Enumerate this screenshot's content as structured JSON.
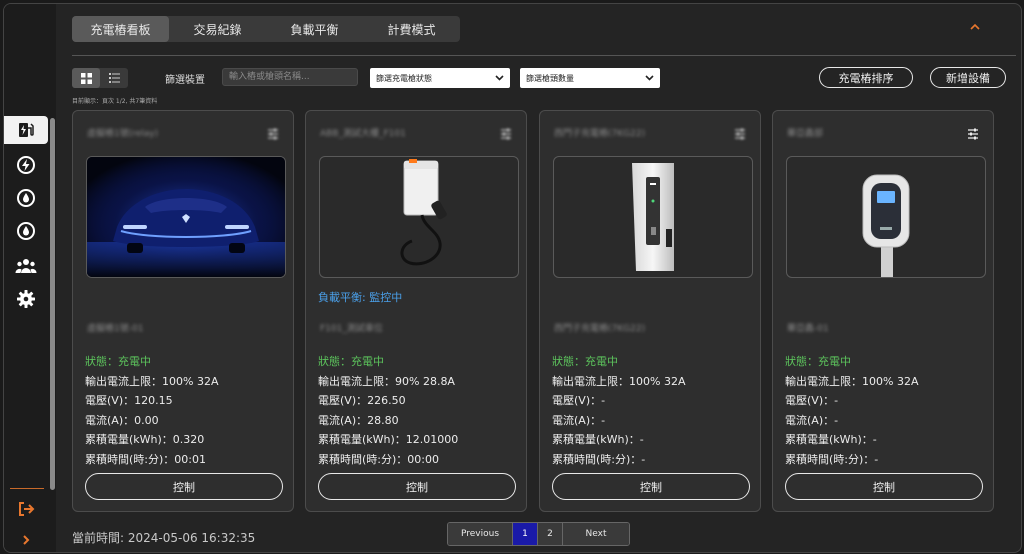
{
  "tabs": [
    "充電樁看板",
    "交易紀錄",
    "負載平衡",
    "計費模式"
  ],
  "toolbar": {
    "filter_label": "篩選裝置",
    "search_placeholder": "輸入樁或槍頭名稱...",
    "status_select": "篩選充電槍狀態",
    "count_select": "篩選槍頭數量",
    "sort_button": "充電樁排序",
    "add_button": "新增設備",
    "status_line": "目前顯示：頁次 1/2, 共7筆資料"
  },
  "cards": [
    {
      "title": "虛擬樁1號(relay)",
      "subtitle": "虛擬樁1號-01",
      "load_balance": "",
      "status": "狀態：充電中",
      "current_limit": "輸出電流上限：100% 32A",
      "voltage": "電壓(V)：120.15",
      "current": "電流(A)：0.00",
      "energy": "累積電量(kWh)：0.320",
      "duration": "累積時間(時:分)：00:01",
      "control": "控制"
    },
    {
      "title": "ABB_測試大樓_F101",
      "subtitle": "F101_測試車位",
      "load_balance": "負載平衡: 監控中",
      "status": "狀態：充電中",
      "current_limit": "輸出電流上限：90% 28.8A",
      "voltage": "電壓(V)：226.50",
      "current": "電流(A)：28.80",
      "energy": "累積電量(kWh)：12.01000",
      "duration": "累積時間(時:分)：00:00",
      "control": "控制"
    },
    {
      "title": "西門子充電樁(7KG22)",
      "subtitle": "西門子充電樁(7KG22)",
      "load_balance": "",
      "status": "狀態：充電中",
      "current_limit": "輸出電流上限：100% 32A",
      "voltage": "電壓(V)：-",
      "current": "電流(A)：-",
      "energy": "累積電量(kWh)：-",
      "duration": "累積時間(時:分)：-",
      "control": "控制"
    },
    {
      "title": "華亞鑫部",
      "subtitle": "華亞鑫-01",
      "load_balance": "",
      "status": "狀態：充電中",
      "current_limit": "輸出電流上限：100% 32A",
      "voltage": "電壓(V)：-",
      "current": "電流(A)：-",
      "energy": "累積電量(kWh)：-",
      "duration": "累積時間(時:分)：-",
      "control": "控制"
    }
  ],
  "footer": {
    "current_time": "當前時間: 2024-05-06 16:32:35",
    "previous": "Previous",
    "page1": "1",
    "page2": "2",
    "next": "Next"
  },
  "icons": {
    "card_menu": "tune-sliders-icon",
    "sidebar": [
      "ev-station-icon",
      "bolt-circle-icon",
      "drop-icon",
      "drop-icon",
      "group-icon",
      "gear-icon",
      "logout-icon",
      "chevron-right-icon"
    ]
  },
  "colors": {
    "accent_orange": "#e8772e",
    "status_green": "#5cc35c",
    "link_blue": "#4a9fe8",
    "page_active": "#1a1aa8"
  }
}
